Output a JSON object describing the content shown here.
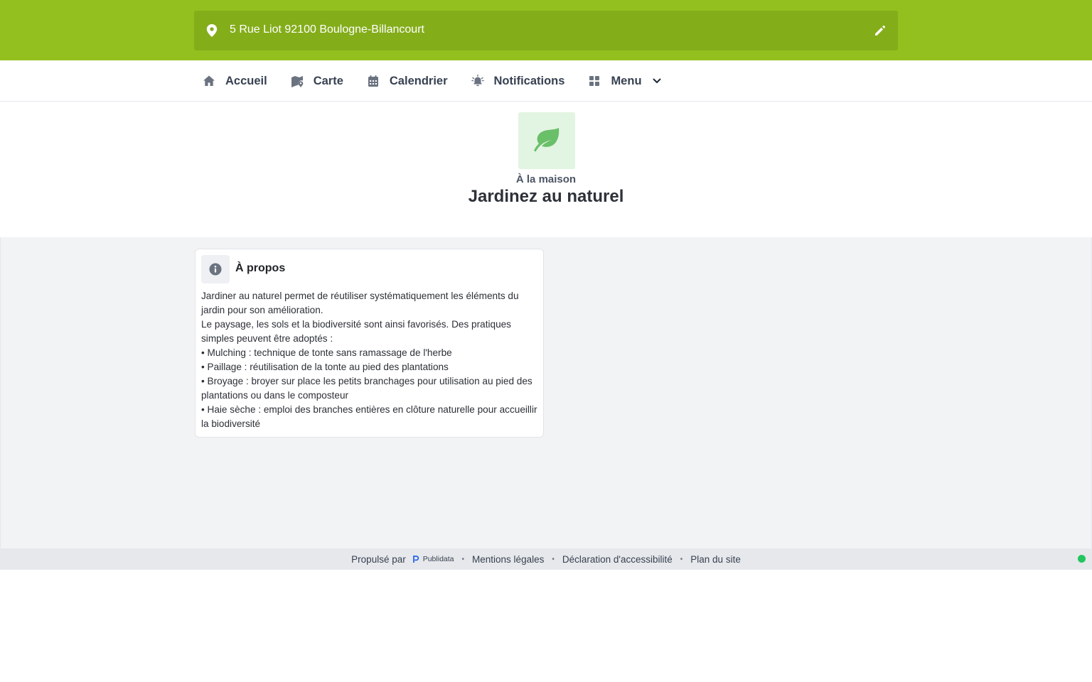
{
  "colors": {
    "brand": "#93c01f",
    "brand_dark": "#84ad1a",
    "leaf": "#6abf69",
    "status_online": "#22c55e"
  },
  "address": {
    "text": "5 Rue Liot 92100 Boulogne-Billancourt",
    "pin_icon": "map-pin-icon",
    "edit_icon": "pencil-icon"
  },
  "nav": {
    "items": [
      {
        "label": "Accueil",
        "icon": "home-icon"
      },
      {
        "label": "Carte",
        "icon": "map-icon"
      },
      {
        "label": "Calendrier",
        "icon": "calendar-icon"
      },
      {
        "label": "Notifications",
        "icon": "bell-icon"
      },
      {
        "label": "Menu",
        "icon": "grid-icon"
      }
    ]
  },
  "header": {
    "category": "À la maison",
    "title": "Jardinez au naturel",
    "icon": "leaf-icon"
  },
  "card": {
    "title": "À propos",
    "icon": "info-icon",
    "lines": [
      "Jardiner au naturel permet de réutiliser systématiquement les éléments du jardin pour son amélioration.",
      "Le paysage, les sols et la biodiversité sont ainsi favorisés. Des pratiques simples peuvent être adoptés :",
      "• Mulching : technique de tonte sans ramassage de l'herbe",
      "• Paillage : réutilisation de la tonte au pied des plantations",
      "• Broyage : broyer sur place les petits branchages pour utilisation au pied des plantations ou dans le composteur",
      "• Haie sèche : emploi des branches entières en clôture naturelle pour accueillir la biodiversité"
    ]
  },
  "footer": {
    "powered_by": "Propulsé par",
    "brand": "Publidata",
    "links": [
      "Mentions légales",
      "Déclaration d'accessibilité",
      "Plan du site"
    ],
    "separator": "•"
  }
}
